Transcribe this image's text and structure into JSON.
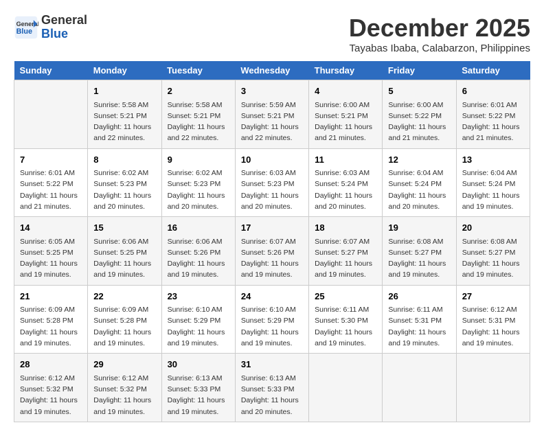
{
  "header": {
    "logo_line1": "General",
    "logo_line2": "Blue",
    "month_title": "December 2025",
    "location": "Tayabas Ibaba, Calabarzon, Philippines"
  },
  "days_of_week": [
    "Sunday",
    "Monday",
    "Tuesday",
    "Wednesday",
    "Thursday",
    "Friday",
    "Saturday"
  ],
  "weeks": [
    [
      {
        "day": "",
        "info": ""
      },
      {
        "day": "1",
        "info": "Sunrise: 5:58 AM\nSunset: 5:21 PM\nDaylight: 11 hours\nand 22 minutes."
      },
      {
        "day": "2",
        "info": "Sunrise: 5:58 AM\nSunset: 5:21 PM\nDaylight: 11 hours\nand 22 minutes."
      },
      {
        "day": "3",
        "info": "Sunrise: 5:59 AM\nSunset: 5:21 PM\nDaylight: 11 hours\nand 22 minutes."
      },
      {
        "day": "4",
        "info": "Sunrise: 6:00 AM\nSunset: 5:21 PM\nDaylight: 11 hours\nand 21 minutes."
      },
      {
        "day": "5",
        "info": "Sunrise: 6:00 AM\nSunset: 5:22 PM\nDaylight: 11 hours\nand 21 minutes."
      },
      {
        "day": "6",
        "info": "Sunrise: 6:01 AM\nSunset: 5:22 PM\nDaylight: 11 hours\nand 21 minutes."
      }
    ],
    [
      {
        "day": "7",
        "info": "Sunrise: 6:01 AM\nSunset: 5:22 PM\nDaylight: 11 hours\nand 21 minutes."
      },
      {
        "day": "8",
        "info": "Sunrise: 6:02 AM\nSunset: 5:23 PM\nDaylight: 11 hours\nand 20 minutes."
      },
      {
        "day": "9",
        "info": "Sunrise: 6:02 AM\nSunset: 5:23 PM\nDaylight: 11 hours\nand 20 minutes."
      },
      {
        "day": "10",
        "info": "Sunrise: 6:03 AM\nSunset: 5:23 PM\nDaylight: 11 hours\nand 20 minutes."
      },
      {
        "day": "11",
        "info": "Sunrise: 6:03 AM\nSunset: 5:24 PM\nDaylight: 11 hours\nand 20 minutes."
      },
      {
        "day": "12",
        "info": "Sunrise: 6:04 AM\nSunset: 5:24 PM\nDaylight: 11 hours\nand 20 minutes."
      },
      {
        "day": "13",
        "info": "Sunrise: 6:04 AM\nSunset: 5:24 PM\nDaylight: 11 hours\nand 19 minutes."
      }
    ],
    [
      {
        "day": "14",
        "info": "Sunrise: 6:05 AM\nSunset: 5:25 PM\nDaylight: 11 hours\nand 19 minutes."
      },
      {
        "day": "15",
        "info": "Sunrise: 6:06 AM\nSunset: 5:25 PM\nDaylight: 11 hours\nand 19 minutes."
      },
      {
        "day": "16",
        "info": "Sunrise: 6:06 AM\nSunset: 5:26 PM\nDaylight: 11 hours\nand 19 minutes."
      },
      {
        "day": "17",
        "info": "Sunrise: 6:07 AM\nSunset: 5:26 PM\nDaylight: 11 hours\nand 19 minutes."
      },
      {
        "day": "18",
        "info": "Sunrise: 6:07 AM\nSunset: 5:27 PM\nDaylight: 11 hours\nand 19 minutes."
      },
      {
        "day": "19",
        "info": "Sunrise: 6:08 AM\nSunset: 5:27 PM\nDaylight: 11 hours\nand 19 minutes."
      },
      {
        "day": "20",
        "info": "Sunrise: 6:08 AM\nSunset: 5:27 PM\nDaylight: 11 hours\nand 19 minutes."
      }
    ],
    [
      {
        "day": "21",
        "info": "Sunrise: 6:09 AM\nSunset: 5:28 PM\nDaylight: 11 hours\nand 19 minutes."
      },
      {
        "day": "22",
        "info": "Sunrise: 6:09 AM\nSunset: 5:28 PM\nDaylight: 11 hours\nand 19 minutes."
      },
      {
        "day": "23",
        "info": "Sunrise: 6:10 AM\nSunset: 5:29 PM\nDaylight: 11 hours\nand 19 minutes."
      },
      {
        "day": "24",
        "info": "Sunrise: 6:10 AM\nSunset: 5:29 PM\nDaylight: 11 hours\nand 19 minutes."
      },
      {
        "day": "25",
        "info": "Sunrise: 6:11 AM\nSunset: 5:30 PM\nDaylight: 11 hours\nand 19 minutes."
      },
      {
        "day": "26",
        "info": "Sunrise: 6:11 AM\nSunset: 5:31 PM\nDaylight: 11 hours\nand 19 minutes."
      },
      {
        "day": "27",
        "info": "Sunrise: 6:12 AM\nSunset: 5:31 PM\nDaylight: 11 hours\nand 19 minutes."
      }
    ],
    [
      {
        "day": "28",
        "info": "Sunrise: 6:12 AM\nSunset: 5:32 PM\nDaylight: 11 hours\nand 19 minutes."
      },
      {
        "day": "29",
        "info": "Sunrise: 6:12 AM\nSunset: 5:32 PM\nDaylight: 11 hours\nand 19 minutes."
      },
      {
        "day": "30",
        "info": "Sunrise: 6:13 AM\nSunset: 5:33 PM\nDaylight: 11 hours\nand 19 minutes."
      },
      {
        "day": "31",
        "info": "Sunrise: 6:13 AM\nSunset: 5:33 PM\nDaylight: 11 hours\nand 20 minutes."
      },
      {
        "day": "",
        "info": ""
      },
      {
        "day": "",
        "info": ""
      },
      {
        "day": "",
        "info": ""
      }
    ]
  ]
}
